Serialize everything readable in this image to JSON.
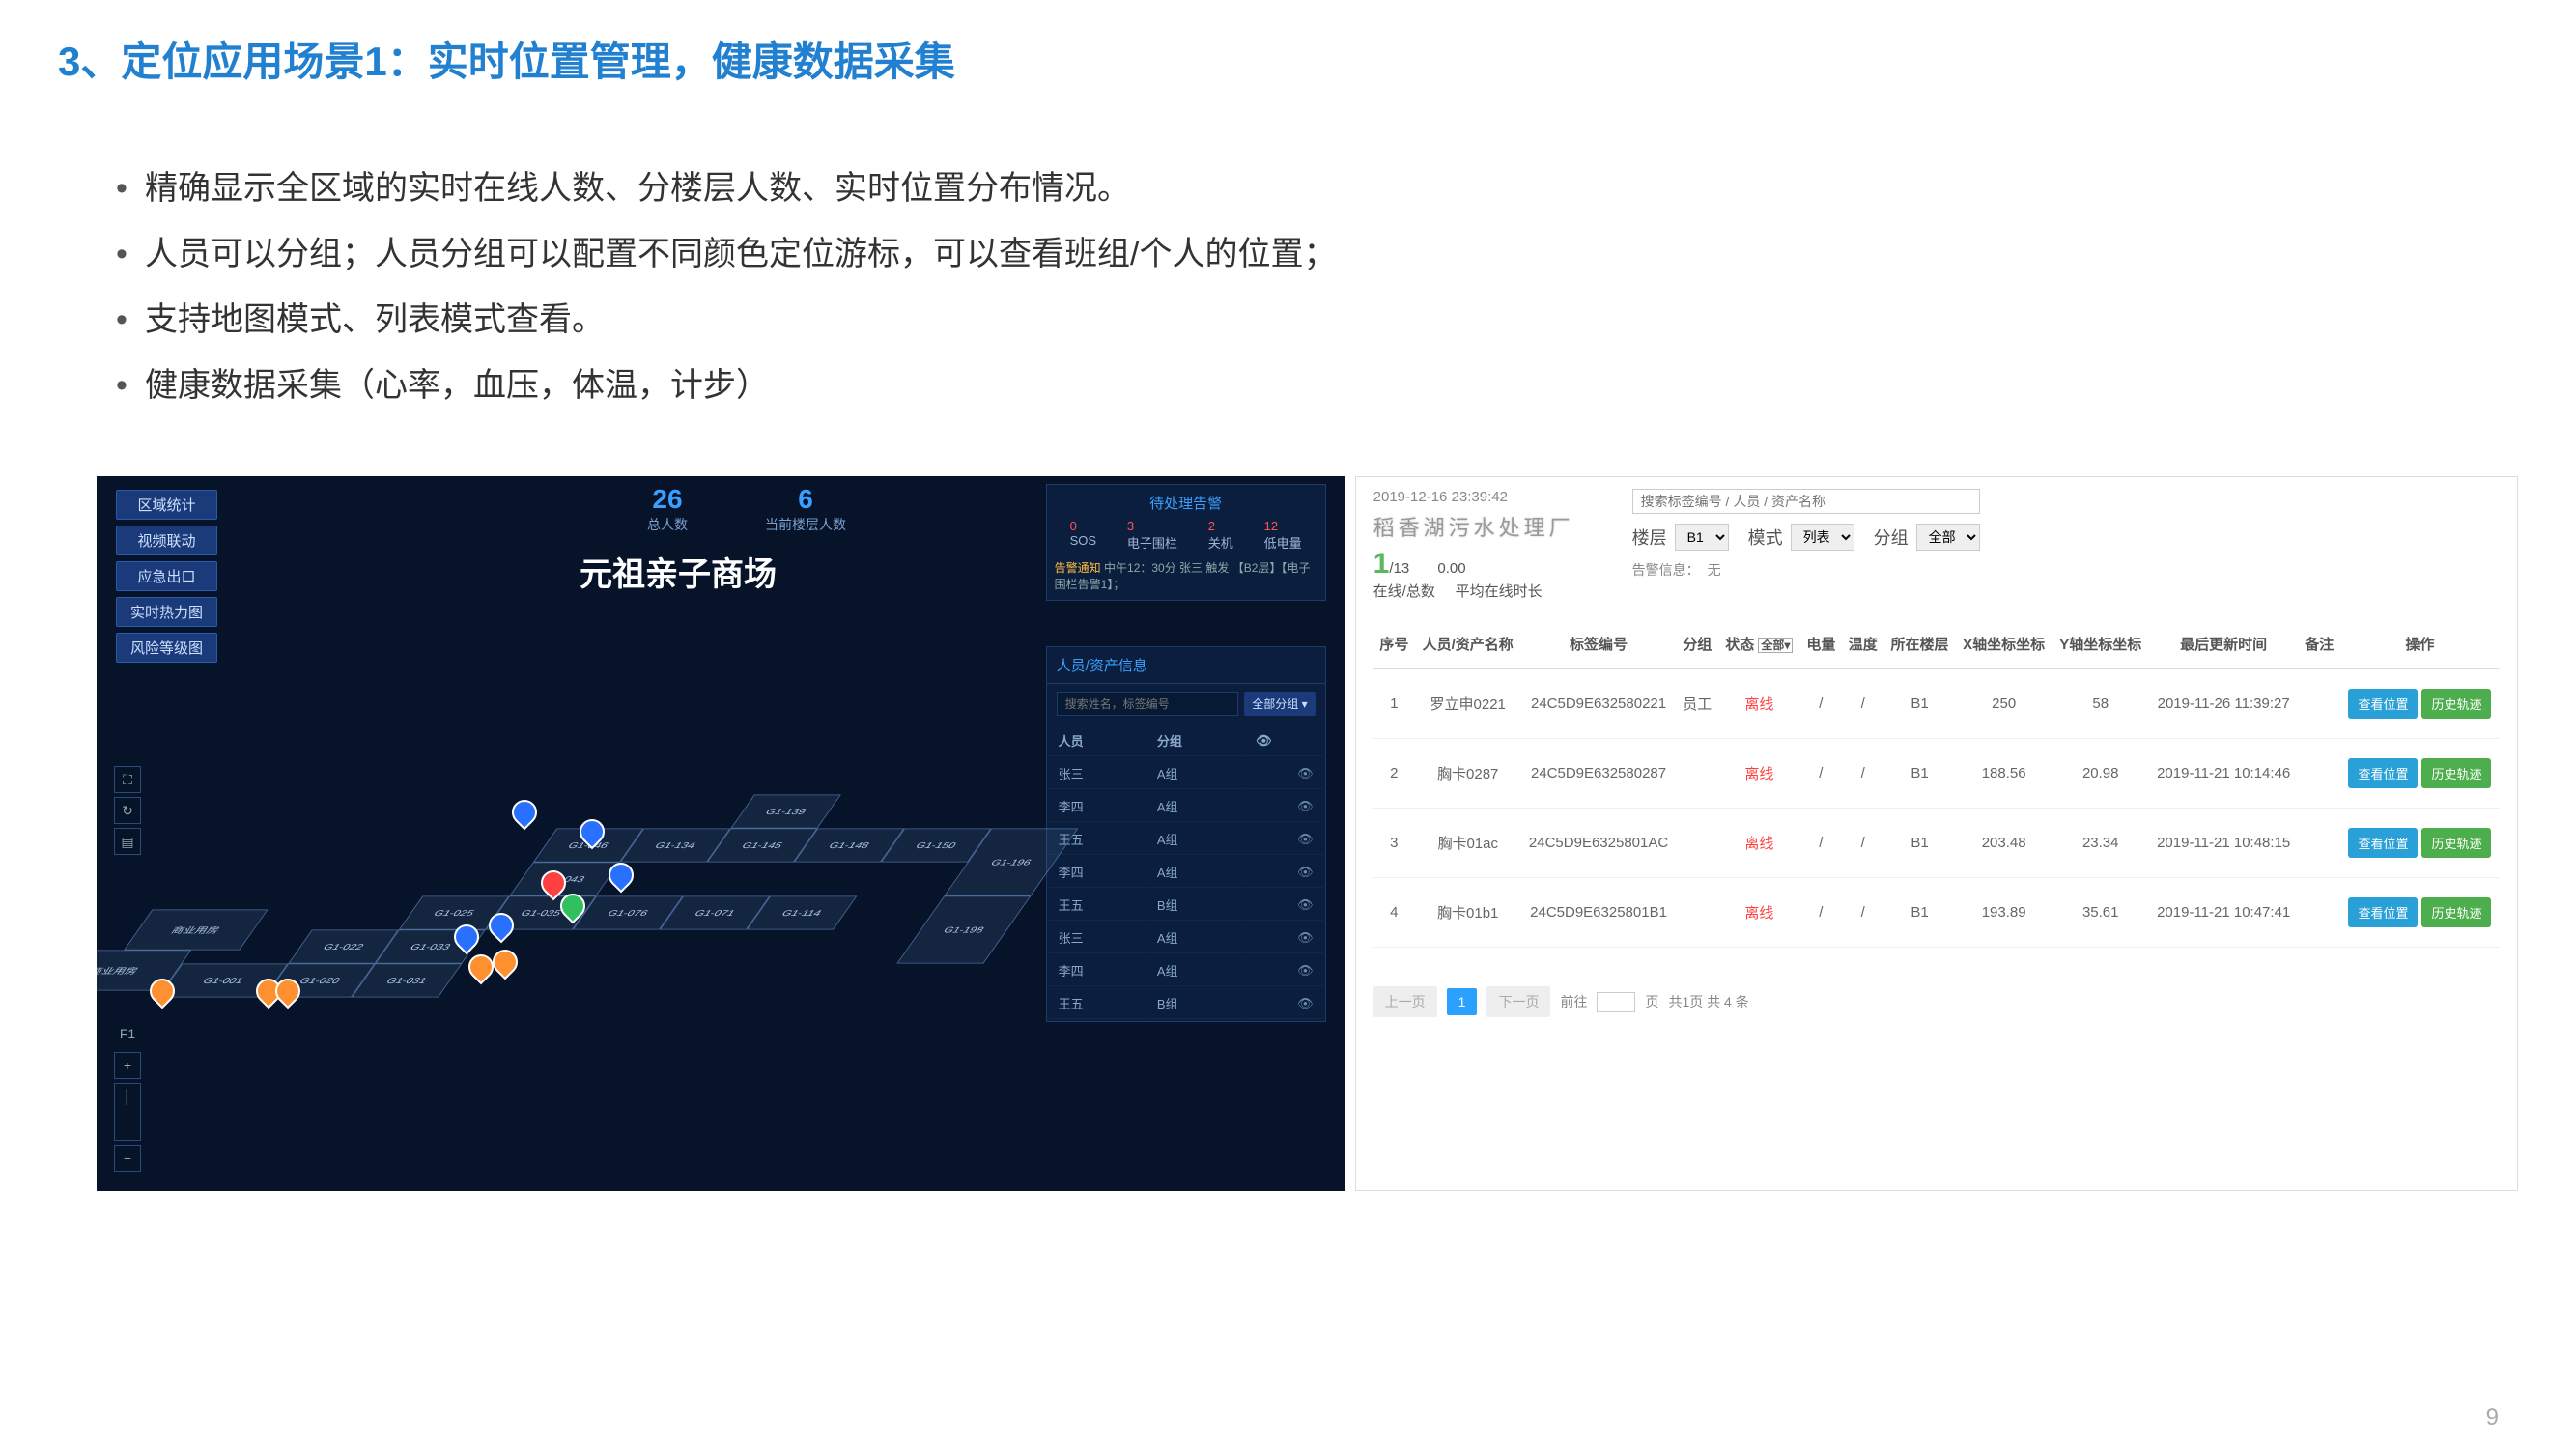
{
  "slide": {
    "title": "3、定位应用场景1：实时位置管理，健康数据采集",
    "bullets": [
      "精确显示全区域的实时在线人数、分楼层人数、实时位置分布情况。",
      "人员可以分组；人员分组可以配置不同颜色定位游标，可以查看班组/个人的位置；",
      "支持地图模式、列表模式查看。",
      "健康数据采集（心率，血压，体温，计步）"
    ],
    "page_number": "9"
  },
  "map": {
    "sidebar": [
      "区域统计",
      "视频联动",
      "应急出口",
      "实时热力图",
      "风险等级图"
    ],
    "stats": [
      {
        "num": "26",
        "label": "总人数"
      },
      {
        "num": "6",
        "label": "当前楼层人数"
      }
    ],
    "title": "元祖亲子商场",
    "alert": {
      "title": "待处理告警",
      "cols": [
        {
          "n": "0",
          "l": "SOS"
        },
        {
          "n": "3",
          "l": "电子围栏"
        },
        {
          "n": "2",
          "l": "关机"
        },
        {
          "n": "12",
          "l": "低电量"
        }
      ],
      "notice_label": "告警通知",
      "notice_text": "中午12：30分 张三 触发 【B2层】【电子围栏告警1】；"
    },
    "asset": {
      "title": "人员/资产信息",
      "search_placeholder": "搜索姓名，标签编号",
      "group_sel": "全部分组 ▾",
      "header": [
        "人员",
        "分组",
        ""
      ],
      "rows": [
        {
          "name": "张三",
          "group": "A组"
        },
        {
          "name": "李四",
          "group": "A组"
        },
        {
          "name": "王五",
          "group": "A组"
        },
        {
          "name": "李四",
          "group": "A组"
        },
        {
          "name": "王五",
          "group": "B组"
        },
        {
          "name": "张三",
          "group": "A组"
        },
        {
          "name": "李四",
          "group": "A组"
        },
        {
          "name": "王五",
          "group": "B组"
        }
      ]
    },
    "rooms": [
      "G1-139",
      "G1-134",
      "G1-145",
      "G1-148",
      "G1-150",
      "G1-196",
      "G1-198",
      "G1-046",
      "G1-043",
      "G1-076",
      "G1-071",
      "G1-114",
      "G1-025",
      "G1-035",
      "G1-022",
      "G1-033",
      "G1-031",
      "G1-020",
      "G1-001",
      "商业用房",
      "商业用房"
    ]
  },
  "list": {
    "timestamp": "2019-12-16 23:39:42",
    "logo": "稻香湖污水处理厂",
    "online": "1",
    "online_total": "/13",
    "online_label": "在线/总数",
    "avg_time": "0.00",
    "avg_label": "平均在线时长",
    "search_placeholder": "搜索标签编号 / 人员 / 资产名称",
    "filter_floor_label": "楼层",
    "filter_floor": "B1",
    "filter_mode_label": "模式",
    "filter_mode": "列表",
    "filter_group_label": "分组",
    "filter_group": "全部",
    "alarm_label": "告警信息：",
    "alarm_value": "无",
    "columns": [
      "序号",
      "人员/资产名称",
      "标签编号",
      "分组",
      "状态",
      "电量",
      "温度",
      "所在楼层",
      "X轴坐标坐标",
      "Y轴坐标坐标",
      "最后更新时间",
      "备注",
      "操作"
    ],
    "status_sel": "全部▾",
    "rows": [
      {
        "idx": "1",
        "name": "罗立申0221",
        "tag": "24C5D9E632580221",
        "group": "员工",
        "status": "离线",
        "batt": "/",
        "temp": "/",
        "floor": "B1",
        "x": "250",
        "y": "58",
        "time": "2019-11-26 11:39:27",
        "note": ""
      },
      {
        "idx": "2",
        "name": "胸卡0287",
        "tag": "24C5D9E632580287",
        "group": "",
        "status": "离线",
        "batt": "/",
        "temp": "/",
        "floor": "B1",
        "x": "188.56",
        "y": "20.98",
        "time": "2019-11-21 10:14:46",
        "note": ""
      },
      {
        "idx": "3",
        "name": "胸卡01ac",
        "tag": "24C5D9E6325801AC",
        "group": "",
        "status": "离线",
        "batt": "/",
        "temp": "/",
        "floor": "B1",
        "x": "203.48",
        "y": "23.34",
        "time": "2019-11-21 10:48:15",
        "note": ""
      },
      {
        "idx": "4",
        "name": "胸卡01b1",
        "tag": "24C5D9E6325801B1",
        "group": "",
        "status": "离线",
        "batt": "/",
        "temp": "/",
        "floor": "B1",
        "x": "193.89",
        "y": "35.61",
        "time": "2019-11-21 10:47:41",
        "note": ""
      }
    ],
    "btn_view": "查看位置",
    "btn_hist": "历史轨迹",
    "pagination": {
      "prev": "上一页",
      "cur": "1",
      "next": "下一页",
      "jump_label": "前往",
      "page_suffix": "页",
      "total": "共1页  共 4 条"
    }
  }
}
